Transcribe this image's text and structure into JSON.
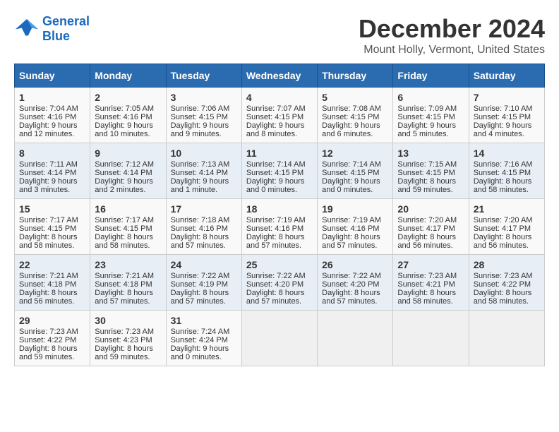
{
  "header": {
    "logo_line1": "General",
    "logo_line2": "Blue",
    "main_title": "December 2024",
    "sub_title": "Mount Holly, Vermont, United States"
  },
  "days_of_week": [
    "Sunday",
    "Monday",
    "Tuesday",
    "Wednesday",
    "Thursday",
    "Friday",
    "Saturday"
  ],
  "weeks": [
    [
      {
        "day": "1",
        "lines": [
          "Sunrise: 7:04 AM",
          "Sunset: 4:16 PM",
          "Daylight: 9 hours",
          "and 12 minutes."
        ]
      },
      {
        "day": "2",
        "lines": [
          "Sunrise: 7:05 AM",
          "Sunset: 4:16 PM",
          "Daylight: 9 hours",
          "and 10 minutes."
        ]
      },
      {
        "day": "3",
        "lines": [
          "Sunrise: 7:06 AM",
          "Sunset: 4:15 PM",
          "Daylight: 9 hours",
          "and 9 minutes."
        ]
      },
      {
        "day": "4",
        "lines": [
          "Sunrise: 7:07 AM",
          "Sunset: 4:15 PM",
          "Daylight: 9 hours",
          "and 8 minutes."
        ]
      },
      {
        "day": "5",
        "lines": [
          "Sunrise: 7:08 AM",
          "Sunset: 4:15 PM",
          "Daylight: 9 hours",
          "and 6 minutes."
        ]
      },
      {
        "day": "6",
        "lines": [
          "Sunrise: 7:09 AM",
          "Sunset: 4:15 PM",
          "Daylight: 9 hours",
          "and 5 minutes."
        ]
      },
      {
        "day": "7",
        "lines": [
          "Sunrise: 7:10 AM",
          "Sunset: 4:15 PM",
          "Daylight: 9 hours",
          "and 4 minutes."
        ]
      }
    ],
    [
      {
        "day": "8",
        "lines": [
          "Sunrise: 7:11 AM",
          "Sunset: 4:14 PM",
          "Daylight: 9 hours",
          "and 3 minutes."
        ]
      },
      {
        "day": "9",
        "lines": [
          "Sunrise: 7:12 AM",
          "Sunset: 4:14 PM",
          "Daylight: 9 hours",
          "and 2 minutes."
        ]
      },
      {
        "day": "10",
        "lines": [
          "Sunrise: 7:13 AM",
          "Sunset: 4:14 PM",
          "Daylight: 9 hours",
          "and 1 minute."
        ]
      },
      {
        "day": "11",
        "lines": [
          "Sunrise: 7:14 AM",
          "Sunset: 4:15 PM",
          "Daylight: 9 hours",
          "and 0 minutes."
        ]
      },
      {
        "day": "12",
        "lines": [
          "Sunrise: 7:14 AM",
          "Sunset: 4:15 PM",
          "Daylight: 9 hours",
          "and 0 minutes."
        ]
      },
      {
        "day": "13",
        "lines": [
          "Sunrise: 7:15 AM",
          "Sunset: 4:15 PM",
          "Daylight: 8 hours",
          "and 59 minutes."
        ]
      },
      {
        "day": "14",
        "lines": [
          "Sunrise: 7:16 AM",
          "Sunset: 4:15 PM",
          "Daylight: 8 hours",
          "and 58 minutes."
        ]
      }
    ],
    [
      {
        "day": "15",
        "lines": [
          "Sunrise: 7:17 AM",
          "Sunset: 4:15 PM",
          "Daylight: 8 hours",
          "and 58 minutes."
        ]
      },
      {
        "day": "16",
        "lines": [
          "Sunrise: 7:17 AM",
          "Sunset: 4:15 PM",
          "Daylight: 8 hours",
          "and 58 minutes."
        ]
      },
      {
        "day": "17",
        "lines": [
          "Sunrise: 7:18 AM",
          "Sunset: 4:16 PM",
          "Daylight: 8 hours",
          "and 57 minutes."
        ]
      },
      {
        "day": "18",
        "lines": [
          "Sunrise: 7:19 AM",
          "Sunset: 4:16 PM",
          "Daylight: 8 hours",
          "and 57 minutes."
        ]
      },
      {
        "day": "19",
        "lines": [
          "Sunrise: 7:19 AM",
          "Sunset: 4:16 PM",
          "Daylight: 8 hours",
          "and 57 minutes."
        ]
      },
      {
        "day": "20",
        "lines": [
          "Sunrise: 7:20 AM",
          "Sunset: 4:17 PM",
          "Daylight: 8 hours",
          "and 56 minutes."
        ]
      },
      {
        "day": "21",
        "lines": [
          "Sunrise: 7:20 AM",
          "Sunset: 4:17 PM",
          "Daylight: 8 hours",
          "and 56 minutes."
        ]
      }
    ],
    [
      {
        "day": "22",
        "lines": [
          "Sunrise: 7:21 AM",
          "Sunset: 4:18 PM",
          "Daylight: 8 hours",
          "and 56 minutes."
        ]
      },
      {
        "day": "23",
        "lines": [
          "Sunrise: 7:21 AM",
          "Sunset: 4:18 PM",
          "Daylight: 8 hours",
          "and 57 minutes."
        ]
      },
      {
        "day": "24",
        "lines": [
          "Sunrise: 7:22 AM",
          "Sunset: 4:19 PM",
          "Daylight: 8 hours",
          "and 57 minutes."
        ]
      },
      {
        "day": "25",
        "lines": [
          "Sunrise: 7:22 AM",
          "Sunset: 4:20 PM",
          "Daylight: 8 hours",
          "and 57 minutes."
        ]
      },
      {
        "day": "26",
        "lines": [
          "Sunrise: 7:22 AM",
          "Sunset: 4:20 PM",
          "Daylight: 8 hours",
          "and 57 minutes."
        ]
      },
      {
        "day": "27",
        "lines": [
          "Sunrise: 7:23 AM",
          "Sunset: 4:21 PM",
          "Daylight: 8 hours",
          "and 58 minutes."
        ]
      },
      {
        "day": "28",
        "lines": [
          "Sunrise: 7:23 AM",
          "Sunset: 4:22 PM",
          "Daylight: 8 hours",
          "and 58 minutes."
        ]
      }
    ],
    [
      {
        "day": "29",
        "lines": [
          "Sunrise: 7:23 AM",
          "Sunset: 4:22 PM",
          "Daylight: 8 hours",
          "and 59 minutes."
        ]
      },
      {
        "day": "30",
        "lines": [
          "Sunrise: 7:23 AM",
          "Sunset: 4:23 PM",
          "Daylight: 8 hours",
          "and 59 minutes."
        ]
      },
      {
        "day": "31",
        "lines": [
          "Sunrise: 7:24 AM",
          "Sunset: 4:24 PM",
          "Daylight: 9 hours",
          "and 0 minutes."
        ]
      },
      null,
      null,
      null,
      null
    ]
  ]
}
